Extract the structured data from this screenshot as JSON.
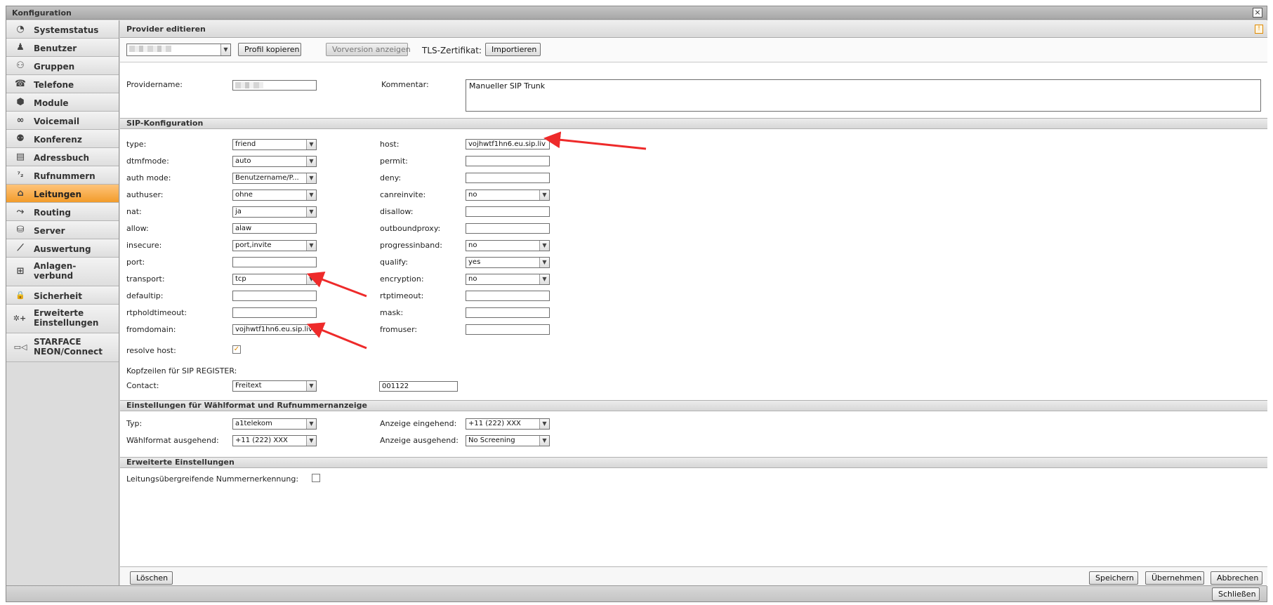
{
  "window": {
    "title": "Konfiguration",
    "close_label": "×"
  },
  "sidebar": {
    "items": [
      {
        "label": "Systemstatus",
        "icon": "clock-icon",
        "glyph": "◔"
      },
      {
        "label": "Benutzer",
        "icon": "user-icon",
        "glyph": "♟"
      },
      {
        "label": "Gruppen",
        "icon": "group-icon",
        "glyph": "⚇"
      },
      {
        "label": "Telefone",
        "icon": "phone-icon",
        "glyph": "☎"
      },
      {
        "label": "Module",
        "icon": "cube-icon",
        "glyph": "⬢"
      },
      {
        "label": "Voicemail",
        "icon": "voicemail-icon",
        "glyph": "∞"
      },
      {
        "label": "Konferenz",
        "icon": "conference-icon",
        "glyph": "⚉"
      },
      {
        "label": "Adressbuch",
        "icon": "addressbook-icon",
        "glyph": "▤"
      },
      {
        "label": "Rufnummern",
        "icon": "numbers-icon",
        "glyph": "⁷₂"
      },
      {
        "label": "Leitungen",
        "icon": "lines-icon",
        "glyph": "⌂"
      },
      {
        "label": "Routing",
        "icon": "routing-icon",
        "glyph": "⤳"
      },
      {
        "label": "Server",
        "icon": "server-icon",
        "glyph": "⛁"
      },
      {
        "label": "Auswertung",
        "icon": "chart-icon",
        "glyph": "⟋"
      },
      {
        "label": "Anlagen-\nverbund",
        "icon": "network-icon",
        "glyph": "⊞"
      },
      {
        "label": "Sicherheit",
        "icon": "lock-icon",
        "glyph": "🔒"
      },
      {
        "label": "Erweiterte\nEinstellungen",
        "icon": "settings-icon",
        "glyph": "✲+"
      },
      {
        "label": "STARFACE\nNEON/Connect",
        "icon": "video-icon",
        "glyph": "▭◁"
      }
    ]
  },
  "panel": {
    "title": "Provider editieren",
    "info_icon": "!"
  },
  "toolbar": {
    "provider_select_value": "",
    "copy_profile": "Profil kopieren",
    "show_previous": "Vorversion anzeigen",
    "tls_label": "TLS-Zertifikat:",
    "import": "Importieren"
  },
  "general": {
    "providername_label": "Providername:",
    "providername_value": "",
    "comment_label": "Kommentar:",
    "comment_value": "Manueller SIP Trunk"
  },
  "sip": {
    "section_title": "SIP-Konfiguration",
    "left": [
      {
        "label": "type:",
        "kind": "select",
        "value": "friend"
      },
      {
        "label": "dtmfmode:",
        "kind": "select",
        "value": "auto"
      },
      {
        "label": "auth mode:",
        "kind": "select",
        "value": "Benutzername/P..."
      },
      {
        "label": "authuser:",
        "kind": "select",
        "value": "ohne"
      },
      {
        "label": "nat:",
        "kind": "select",
        "value": "ja"
      },
      {
        "label": "allow:",
        "kind": "input",
        "value": "alaw"
      },
      {
        "label": "insecure:",
        "kind": "select",
        "value": "port,invite"
      },
      {
        "label": "port:",
        "kind": "input",
        "value": ""
      },
      {
        "label": "transport:",
        "kind": "select",
        "value": "tcp"
      },
      {
        "label": "defaultip:",
        "kind": "input",
        "value": ""
      },
      {
        "label": "rtpholdtimeout:",
        "kind": "input",
        "value": ""
      },
      {
        "label": "fromdomain:",
        "kind": "input",
        "value": "vojhwtf1hn6.eu.sip.liv"
      }
    ],
    "right": [
      {
        "label": "host:",
        "kind": "input",
        "value": "vojhwtf1hn6.eu.sip.liv"
      },
      {
        "label": "permit:",
        "kind": "input",
        "value": ""
      },
      {
        "label": "deny:",
        "kind": "input",
        "value": ""
      },
      {
        "label": "canreinvite:",
        "kind": "select",
        "value": "no"
      },
      {
        "label": "disallow:",
        "kind": "input",
        "value": ""
      },
      {
        "label": "outboundproxy:",
        "kind": "input",
        "value": ""
      },
      {
        "label": "progressinband:",
        "kind": "select",
        "value": "no"
      },
      {
        "label": "qualify:",
        "kind": "select",
        "value": "yes"
      },
      {
        "label": "encryption:",
        "kind": "select",
        "value": "no"
      },
      {
        "label": "rtptimeout:",
        "kind": "input",
        "value": ""
      },
      {
        "label": "mask:",
        "kind": "input",
        "value": ""
      },
      {
        "label": "fromuser:",
        "kind": "input",
        "value": ""
      }
    ],
    "resolve_host_label": "resolve host:",
    "resolve_host_checked": true,
    "register_headers_label": "Kopfzeilen für SIP REGISTER:",
    "contact_label": "Contact:",
    "contact_select": "Freitext",
    "contact_value": "001122"
  },
  "numberformat": {
    "section_title": "Einstellungen für Wählformat und Rufnummernanzeige",
    "type_label": "Typ:",
    "type_value": "a1telekom",
    "dialformat_label": "Wählformat ausgehend:",
    "dialformat_value": "+11 (222) XXX",
    "incoming_label": "Anzeige eingehend:",
    "incoming_value": "+11 (222) XXX",
    "outgoing_label": "Anzeige ausgehend:",
    "outgoing_value": "No Screening"
  },
  "advanced": {
    "section_title": "Erweiterte Einstellungen",
    "cross_line_label": "Leitungsübergreifende Nummernerkennung:",
    "cross_line_checked": false
  },
  "footer": {
    "delete": "Löschen",
    "save": "Speichern",
    "apply": "Übernehmen",
    "cancel": "Abbrechen"
  },
  "window_footer": {
    "close": "Schließen"
  },
  "colors": {
    "active_nav": "#f29c2b",
    "annotation_arrow": "#ee2a2a"
  }
}
